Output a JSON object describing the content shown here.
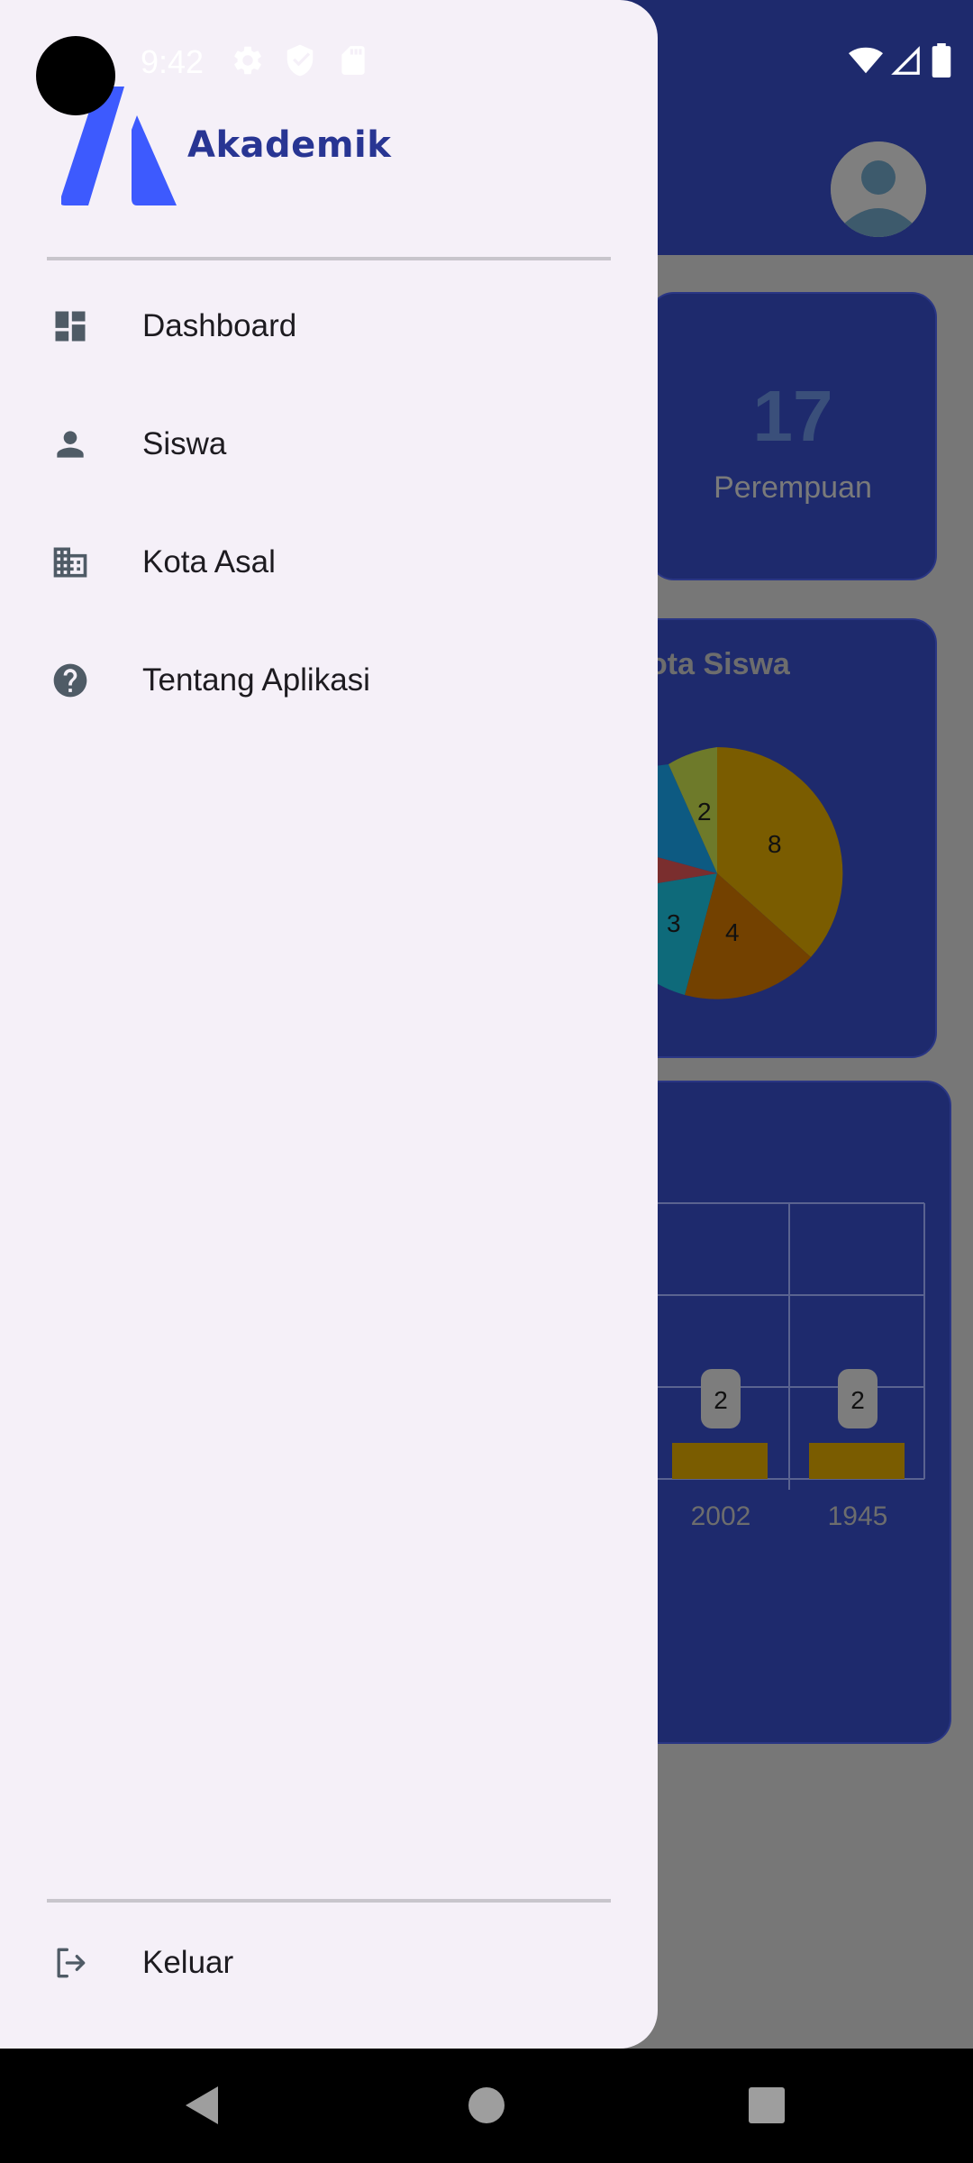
{
  "status_bar": {
    "time": "9:42",
    "icons": [
      "settings-icon",
      "shield-icon",
      "sd-card-icon",
      "wifi-icon",
      "signal-icon",
      "battery-icon"
    ]
  },
  "drawer": {
    "brand": "Akademik",
    "items": [
      {
        "label": "Dashboard",
        "icon": "dashboard-icon"
      },
      {
        "label": "Siswa",
        "icon": "person-icon"
      },
      {
        "label": "Kota Asal",
        "icon": "city-icon"
      },
      {
        "label": "Tentang Aplikasi",
        "icon": "help-icon"
      }
    ],
    "logout_label": "Keluar"
  },
  "background": {
    "stat_card": {
      "value": "17",
      "label": "Perempuan"
    },
    "pie_card": {
      "title_visible": "ota Siswa",
      "slice_labels": [
        "2",
        "8",
        "4",
        "3"
      ]
    },
    "bar_card": {
      "bar_value_labels": [
        "2",
        "2"
      ],
      "x_labels": [
        "2002",
        "1945"
      ]
    }
  },
  "colors": {
    "appbar": "#1e2a6d",
    "drawer_bg": "#f5f0f8",
    "brand_blue": "#3d5afe",
    "brand_text": "#283593",
    "icon_gray": "#4f5b66"
  }
}
